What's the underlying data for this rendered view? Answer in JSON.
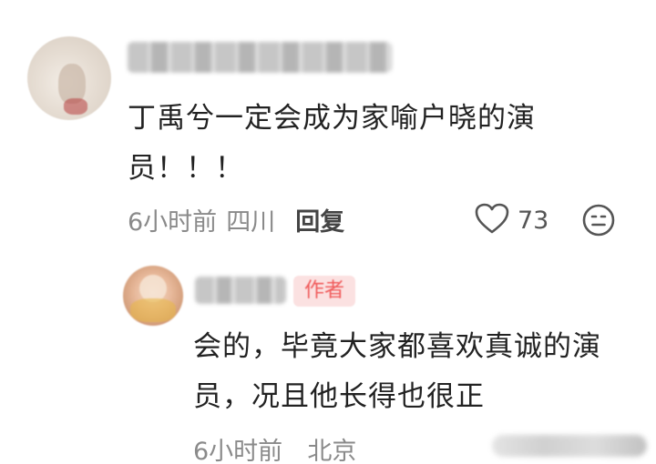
{
  "comment": {
    "text": "丁禹兮一定会成为家喻户晓的演员！！！",
    "time": "6小时前",
    "location": "四川",
    "reply_label": "回复",
    "like_count": "73"
  },
  "reply": {
    "badge": "作者",
    "text": "会的，毕竟大家都喜欢真诚的演员，况且他长得也很正",
    "time": "6小时前",
    "location": "北京"
  },
  "icons": {
    "like": "heart-outline-icon",
    "emoji": "neutral-face-icon"
  },
  "colors": {
    "text": "#222222",
    "meta": "#8a8a8a",
    "badge_bg": "#fbe1e1",
    "badge_text": "#f05a5a"
  }
}
